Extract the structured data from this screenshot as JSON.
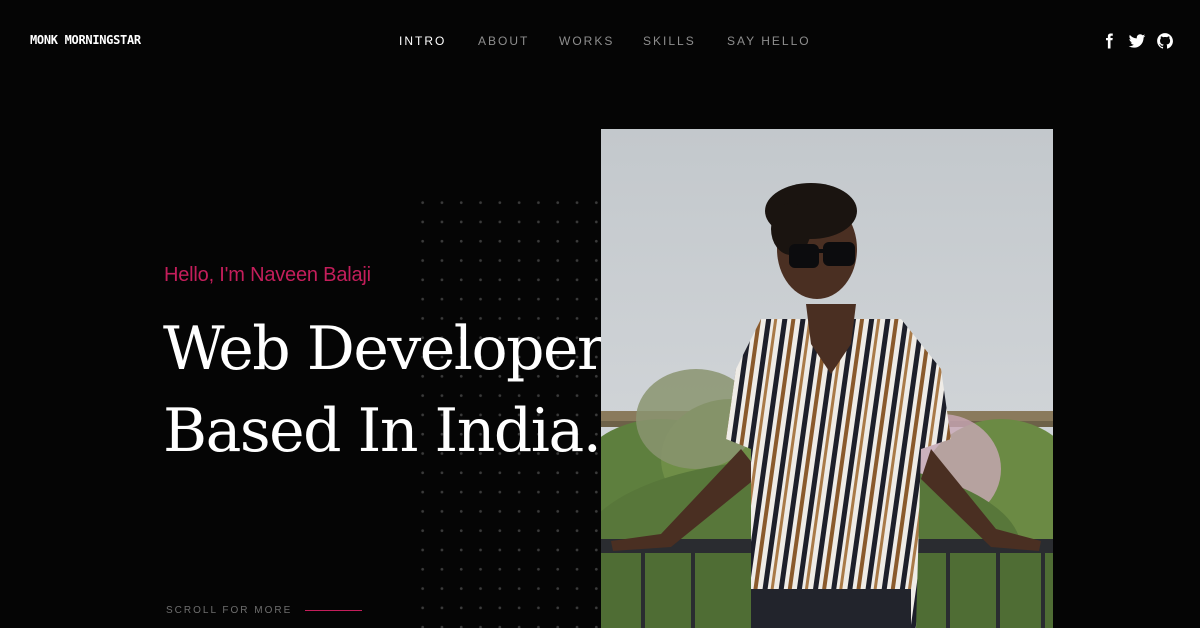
{
  "header": {
    "logo": "MONK MORNINGSTAR",
    "nav": [
      "INTRO",
      "ABOUT",
      "WORKS",
      "SKILLS",
      "SAY HELLO"
    ],
    "active_nav": "INTRO",
    "socials": [
      "facebook-icon",
      "twitter-icon",
      "github-icon"
    ]
  },
  "hero": {
    "greeting": "Hello, I'm Naveen Balaji",
    "headline_line1": "Web Developer",
    "headline_line2": "Based In India.",
    "scroll_label": "SCROLL FOR MORE"
  },
  "colors": {
    "accent": "#c41e5b",
    "background": "#050505",
    "text": "#ffffff",
    "nav_inactive": "#8e8e8e"
  }
}
